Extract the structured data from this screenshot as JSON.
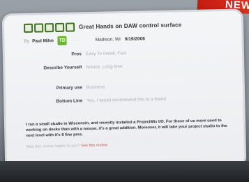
{
  "banner": {
    "text": "NEW"
  },
  "review": {
    "title": "Great Hands on DAW control surface",
    "rating_stars": 5,
    "accent": "#3f6f22",
    "byline": {
      "prefix": "By",
      "author": "Paul Mihn",
      "badge": "TD",
      "location": "Madison, WI",
      "date": "9/19/2008"
    },
    "fields": [
      {
        "label": "Pros",
        "value": "Easy To Install, Fast"
      },
      {
        "label": "Describe Yourself",
        "value": "Novice, Long-time"
      },
      {
        "label": "Primary use",
        "value": "Business"
      },
      {
        "label": "Bottom Line",
        "value": "Yes, I would recommend this to a friend"
      }
    ],
    "body": "I run a small studio in Wisconsin, and recently installed a ProjectMix I/O. For those of us more used to working on desks than with a mouse, it's a great addition. Moreover, it will take your project studio to the next level with it's 8 fine pres.",
    "helpful": "Was this review helpful to you?",
    "helpful_link": "See this review"
  }
}
